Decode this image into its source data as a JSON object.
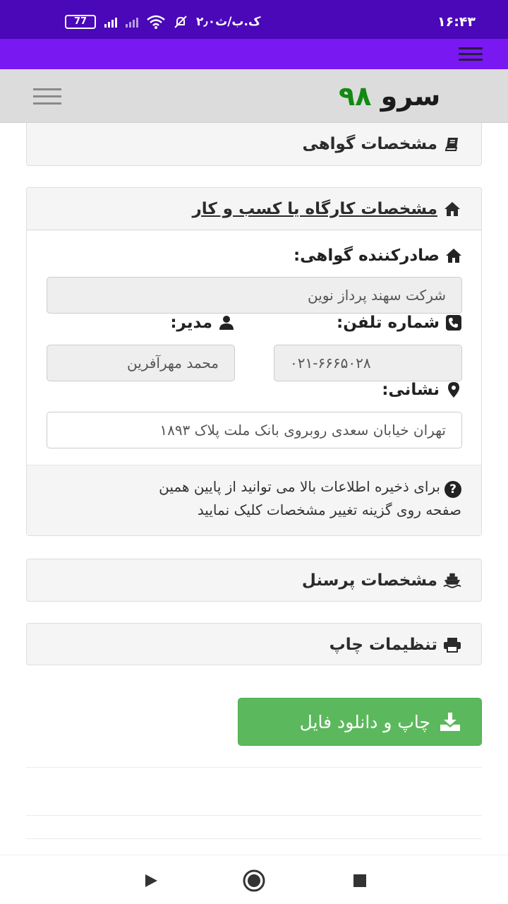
{
  "status_bar": {
    "time": "۱۶:۴۳",
    "speed": "۲٫۰ک.ب/ث",
    "battery": "77"
  },
  "app": {
    "logo_word": "سرو",
    "logo_number": "۹۸"
  },
  "panels": {
    "certificate": {
      "title": "مشخصات گواهی",
      "icon": "book-icon"
    },
    "workplace": {
      "title": "مشخصات کارگاه یا کسب و کار",
      "icon": "home-icon",
      "issuer_label": "صادرکننده گواهی:",
      "issuer_value": "شرکت سهند پرداز نوین",
      "phone_label": "شماره تلفن:",
      "phone_value": "۰۲۱-۶۶۶۵۰۲۸",
      "manager_label": "مدیر:",
      "manager_value": "محمد مهرآفرین",
      "address_label": "نشانی:",
      "address_value": "تهران خیابان سعدی روبروی بانک ملت پلاک ۱۸۹۳",
      "help_line1": "برای ذخیره اطلاعات بالا می توانید از پایین همین",
      "help_line2": "صفحه روی گزینه تغییر مشخصات کلیک نمایید"
    },
    "personnel": {
      "title": "مشخصات پرسنل",
      "icon": "ship-icon"
    },
    "print": {
      "title": "تنظیمات چاپ",
      "icon": "print-icon"
    }
  },
  "download_button": {
    "label": "چاپ و دانلود فایل",
    "icon": "download-icon"
  },
  "colors": {
    "status_bar": "#4a08b8",
    "nav_bar": "#7a18f2",
    "logo_number": "#128a12",
    "button": "#5cb85c"
  }
}
